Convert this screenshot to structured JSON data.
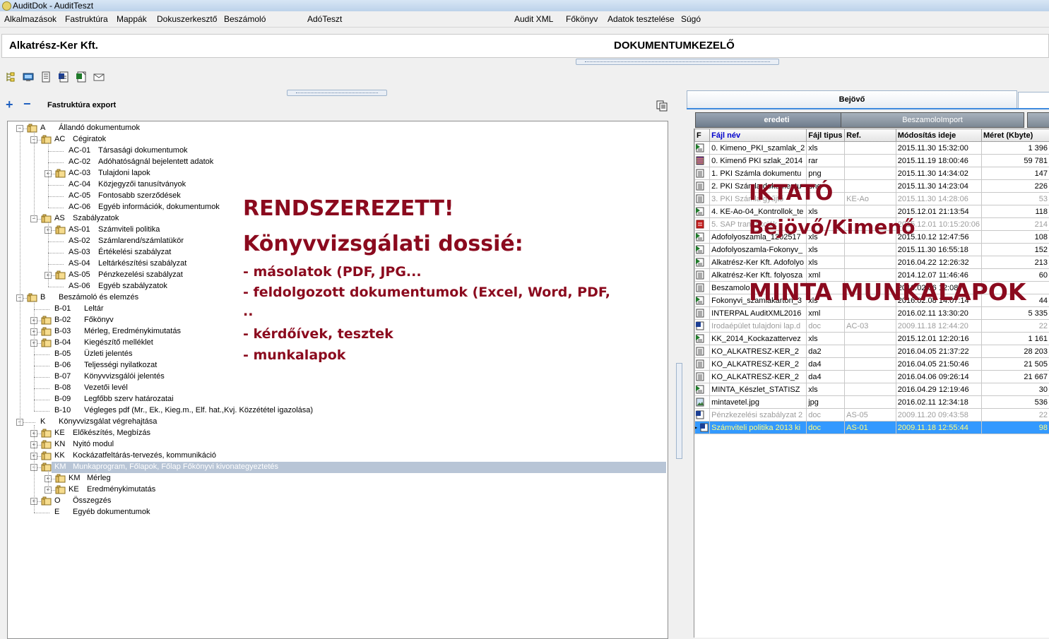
{
  "window": {
    "title": "AuditDok - AuditTeszt"
  },
  "menu": {
    "items": [
      "Alkalmazások",
      "Fastruktúra",
      "Mappák",
      "Dokuszerkesztő",
      "Beszámoló",
      "AdóTeszt",
      "Audit XML",
      "Főkönyv",
      "Adatok tesztelése",
      "Súgó"
    ]
  },
  "header": {
    "company": "Alkatrész-Ker Kft.",
    "module": "DOKUMENTUMKEZELŐ"
  },
  "toolbar": {
    "icons": [
      "tree-icon",
      "monitor-icon",
      "document-icon",
      "word-doc-icon",
      "excel-export-icon",
      "envelope-icon"
    ]
  },
  "tree_toolbar": {
    "expand_all": "+",
    "collapse_all": "−",
    "export_label": "Fastruktúra export"
  },
  "tree": {
    "nodes": [
      {
        "level": 0,
        "exp": "-",
        "folder": true,
        "code": "A",
        "label": "Állandó dokumentumok"
      },
      {
        "level": 1,
        "exp": "-",
        "folder": true,
        "code": "AC",
        "label": "Cégiratok"
      },
      {
        "level": 2,
        "exp": "",
        "folder": false,
        "code": "AC-01",
        "label": "Társasági dokumentumok"
      },
      {
        "level": 2,
        "exp": "",
        "folder": false,
        "code": "AC-02",
        "label": "Adóhatóságnál bejelentett adatok"
      },
      {
        "level": 2,
        "exp": "+",
        "folder": true,
        "code": "AC-03",
        "label": "Tulajdoni lapok"
      },
      {
        "level": 2,
        "exp": "",
        "folder": false,
        "code": "AC-04",
        "label": "Közjegyzői tanusítványok"
      },
      {
        "level": 2,
        "exp": "",
        "folder": false,
        "code": "AC-05",
        "label": "Fontosabb szerződések"
      },
      {
        "level": 2,
        "exp": "",
        "folder": false,
        "code": "AC-06",
        "label": "Egyéb információk, dokumentumok"
      },
      {
        "level": 1,
        "exp": "-",
        "folder": true,
        "code": "AS",
        "label": "Szabályzatok"
      },
      {
        "level": 2,
        "exp": "+",
        "folder": true,
        "code": "AS-01",
        "label": "Számviteli politika"
      },
      {
        "level": 2,
        "exp": "",
        "folder": false,
        "code": "AS-02",
        "label": "Számlarend/számlatükör"
      },
      {
        "level": 2,
        "exp": "",
        "folder": false,
        "code": "AS-03",
        "label": "Értékelési szabályzat"
      },
      {
        "level": 2,
        "exp": "",
        "folder": false,
        "code": "AS-04",
        "label": "Leltárkészítési szabályzat"
      },
      {
        "level": 2,
        "exp": "+",
        "folder": true,
        "code": "AS-05",
        "label": "Pénzkezelési szabályzat"
      },
      {
        "level": 2,
        "exp": "",
        "folder": false,
        "code": "AS-06",
        "label": "Egyéb szabályzatok"
      },
      {
        "level": 0,
        "exp": "-",
        "folder": true,
        "code": "B",
        "label": "Beszámoló és elemzés"
      },
      {
        "level": 1,
        "exp": "",
        "folder": false,
        "code": "B-01",
        "label": "Leltár"
      },
      {
        "level": 1,
        "exp": "+",
        "folder": true,
        "code": "B-02",
        "label": "Főkönyv"
      },
      {
        "level": 1,
        "exp": "+",
        "folder": true,
        "code": "B-03",
        "label": "Mérleg, Eredménykimutatás"
      },
      {
        "level": 1,
        "exp": "+",
        "folder": true,
        "code": "B-04",
        "label": "Kiegészítő melléklet"
      },
      {
        "level": 1,
        "exp": "",
        "folder": false,
        "code": "B-05",
        "label": "Üzleti jelentés"
      },
      {
        "level": 1,
        "exp": "",
        "folder": false,
        "code": "B-06",
        "label": "Teljességi nyilatkozat"
      },
      {
        "level": 1,
        "exp": "",
        "folder": false,
        "code": "B-07",
        "label": "Könyvvizsgálói jelentés"
      },
      {
        "level": 1,
        "exp": "",
        "folder": false,
        "code": "B-08",
        "label": "Vezetői levél"
      },
      {
        "level": 1,
        "exp": "",
        "folder": false,
        "code": "B-09",
        "label": "Legfőbb szerv határozatai"
      },
      {
        "level": 1,
        "exp": "",
        "folder": false,
        "code": "B-10",
        "label": "Végleges pdf (Mr., Ek., Kieg.m., Elf. hat.,Kvj. Közzététel igazolása)"
      },
      {
        "level": 0,
        "exp": "-",
        "folder": false,
        "code": "K",
        "label": "Könyvvizsgálat végrehajtása"
      },
      {
        "level": 1,
        "exp": "+",
        "folder": true,
        "code": "KE",
        "label": "Előkészítés, Megbízás"
      },
      {
        "level": 1,
        "exp": "+",
        "folder": true,
        "code": "KN",
        "label": "Nyitó modul"
      },
      {
        "level": 1,
        "exp": "+",
        "folder": true,
        "code": "KK",
        "label": "Kockázatfeltárás-tervezés, kommunikáció"
      },
      {
        "level": 1,
        "exp": "-",
        "folder": true,
        "code": "KM",
        "label": "Munkaprogram, Főlapok, Főlap Főkönyvi kivonategyeztetés",
        "selected": true
      },
      {
        "level": 2,
        "exp": "+",
        "folder": true,
        "code": "KM",
        "label": "Mérleg"
      },
      {
        "level": 2,
        "exp": "+",
        "folder": true,
        "code": "KE",
        "label": "Eredménykimutatás"
      },
      {
        "level": 1,
        "exp": "+",
        "folder": true,
        "code": "O",
        "label": "Összegzés"
      },
      {
        "level": 1,
        "exp": "",
        "folder": false,
        "code": "E",
        "label": "Egyéb dokumentumok"
      }
    ]
  },
  "right": {
    "tabs": [
      "Bejövő",
      ""
    ],
    "subtabs": [
      "eredeti",
      "BeszamoloImport",
      ""
    ],
    "grid": {
      "columns": [
        "F",
        "Fájl név",
        "Fájl tipus",
        "Ref.",
        "Módosítás ideje",
        "Méret (Kbyte)"
      ],
      "rows": [
        {
          "icon": "excel",
          "name": "0. Kimeno_PKI_szamlak_2",
          "type": "xls",
          "ref": "",
          "date": "2015.11.30 15:32:00",
          "size": "1 396",
          "gray": false
        },
        {
          "icon": "rar",
          "name": "0. Kimenő PKI szlak_2014",
          "type": "rar",
          "ref": "",
          "date": "2015.11.19 18:00:46",
          "size": "59 781",
          "gray": false
        },
        {
          "icon": "doc",
          "name": "1. PKI Számla dokumentu",
          "type": "png",
          "ref": "",
          "date": "2015.11.30 14:34:02",
          "size": "147",
          "gray": false
        },
        {
          "icon": "doc",
          "name": "2. PKI Számla dokumentu",
          "type": "png",
          "ref": "",
          "date": "2015.11.30 14:23:04",
          "size": "226",
          "gray": false
        },
        {
          "icon": "doc",
          "name": "3. PKI Számla gyűjtő",
          "type": "",
          "ref": "KE-Ao",
          "date": "2015.11.30 14:28:06",
          "size": "53",
          "gray": true
        },
        {
          "icon": "excel",
          "name": "4. KE-Ao-04_Kontrollok_te",
          "type": "xls",
          "ref": "",
          "date": "2015.12.01 21:13:54",
          "size": "118",
          "gray": false
        },
        {
          "icon": "pdf",
          "name": "5. SAP tranzakciók",
          "type": "",
          "ref": "",
          "date": "2015.12.01 10:15:20:06",
          "size": "214",
          "gray": true
        },
        {
          "icon": "excel",
          "name": "Adofolyoszamla_1202517",
          "type": "xls",
          "ref": "",
          "date": "2015.10.12 12:47:56",
          "size": "108",
          "gray": false
        },
        {
          "icon": "excel",
          "name": "Adofolyoszamla-Fokonyv_",
          "type": "xls",
          "ref": "",
          "date": "2015.11.30 16:55:18",
          "size": "152",
          "gray": false
        },
        {
          "icon": "excel",
          "name": "Alkatrész-Ker Kft. Adofolyo",
          "type": "xls",
          "ref": "",
          "date": "2016.04.22 12:26:32",
          "size": "213",
          "gray": false
        },
        {
          "icon": "doc",
          "name": "Alkatrész-Ker Kft. folyosza",
          "type": "xml",
          "ref": "",
          "date": "2014.12.07 11:46:46",
          "size": "60",
          "gray": false
        },
        {
          "icon": "doc",
          "name": "Beszamolo",
          "type": "",
          "ref": "",
          "date": "2016.02.06 12:08",
          "size": "",
          "gray": false
        },
        {
          "icon": "excel",
          "name": "Fokonyvi_szamlakarton_3",
          "type": "xls",
          "ref": "",
          "date": "2016.02.08 14:07:14",
          "size": "44",
          "gray": false
        },
        {
          "icon": "doc",
          "name": "INTERPAL AuditXML2016",
          "type": "xml",
          "ref": "",
          "date": "2016.02.11 13:30:20",
          "size": "5 335",
          "gray": false
        },
        {
          "icon": "word",
          "name": "Irodaépület tulajdoni lap.d",
          "type": "doc",
          "ref": "AC-03",
          "date": "2009.11.18 12:44:20",
          "size": "22",
          "gray": true
        },
        {
          "icon": "excel",
          "name": "KK_2014_Kockazattervez",
          "type": "xls",
          "ref": "",
          "date": "2015.12.01 12:20:16",
          "size": "1 161",
          "gray": false
        },
        {
          "icon": "doc",
          "name": "KO_ALKATRESZ-KER_2",
          "type": "da2",
          "ref": "",
          "date": "2016.04.05 21:37:22",
          "size": "28 203",
          "gray": false
        },
        {
          "icon": "doc",
          "name": "KO_ALKATRESZ-KER_2",
          "type": "da4",
          "ref": "",
          "date": "2016.04.05 21:50:46",
          "size": "21 505",
          "gray": false
        },
        {
          "icon": "doc",
          "name": "KO_ALKATRESZ-KER_2",
          "type": "da4",
          "ref": "",
          "date": "2016.04.06 09:26:14",
          "size": "21 667",
          "gray": false
        },
        {
          "icon": "excel",
          "name": "MINTA_Készlet_STATISZ",
          "type": "xls",
          "ref": "",
          "date": "2016.04.29 12:19:46",
          "size": "30",
          "gray": false
        },
        {
          "icon": "img",
          "name": "mintavetel.jpg",
          "type": "jpg",
          "ref": "",
          "date": "2016.02.11 12:34:18",
          "size": "536",
          "gray": false
        },
        {
          "icon": "word",
          "name": "Pénzkezelési szabályzat 2",
          "type": "doc",
          "ref": "AS-05",
          "date": "2009.11.20 09:43:58",
          "size": "22",
          "gray": true
        },
        {
          "icon": "word",
          "name": "Számviteli politika 2013 ki",
          "type": "doc",
          "ref": "AS-01",
          "date": "2009.11.18 12:55:44",
          "size": "98",
          "gray": false,
          "selected": true
        }
      ]
    }
  },
  "overlays": {
    "left_title": "RENDSZEREZETT!",
    "left_subtitle": "Könyvvizsgálati dossié:",
    "left_bullets": [
      "- másolatok (PDF, JPG...",
      "- feldolgozott dokumentumok (Excel, Word, PDF,",
      "..",
      "- kérdőívek, tesztek",
      "- munkalapok"
    ],
    "right_1": "IKTATÓ",
    "right_2": "Bejövő/Kimenő",
    "right_3": "MINTA MUNKALAPOK"
  },
  "colors": {
    "overlay_text": "#8b0a1e",
    "selection": "#3399ff",
    "tree_selection": "#b8c5d6"
  }
}
